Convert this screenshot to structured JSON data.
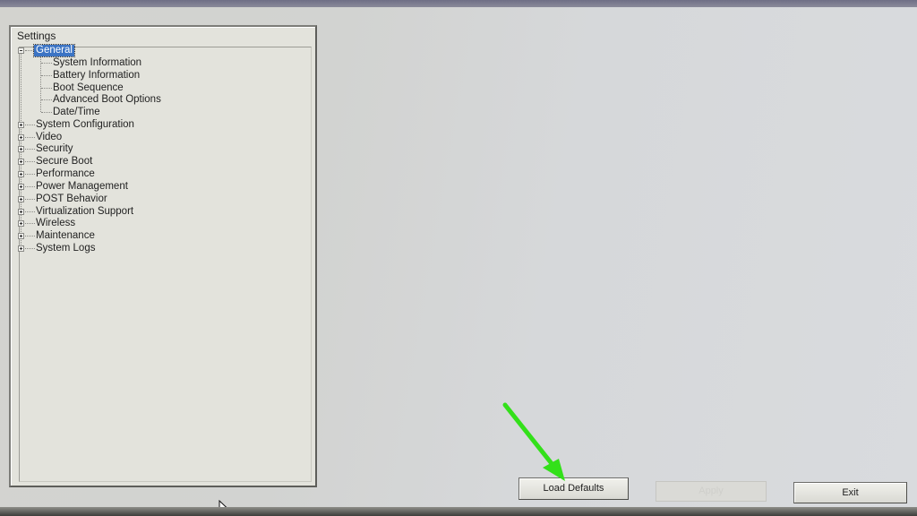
{
  "tree": {
    "title": "Settings",
    "items": [
      {
        "label": "General",
        "level": 0,
        "expander": "minus",
        "selected": true
      },
      {
        "label": "System Information",
        "level": 1
      },
      {
        "label": "Battery Information",
        "level": 1
      },
      {
        "label": "Boot Sequence",
        "level": 1
      },
      {
        "label": "Advanced Boot Options",
        "level": 1
      },
      {
        "label": "Date/Time",
        "level": 1
      },
      {
        "label": "System Configuration",
        "level": 0,
        "expander": "plus"
      },
      {
        "label": "Video",
        "level": 0,
        "expander": "plus"
      },
      {
        "label": "Security",
        "level": 0,
        "expander": "plus"
      },
      {
        "label": "Secure Boot",
        "level": 0,
        "expander": "plus"
      },
      {
        "label": "Performance",
        "level": 0,
        "expander": "plus"
      },
      {
        "label": "Power Management",
        "level": 0,
        "expander": "plus"
      },
      {
        "label": "POST Behavior",
        "level": 0,
        "expander": "plus"
      },
      {
        "label": "Virtualization Support",
        "level": 0,
        "expander": "plus"
      },
      {
        "label": "Wireless",
        "level": 0,
        "expander": "plus"
      },
      {
        "label": "Maintenance",
        "level": 0,
        "expander": "plus"
      },
      {
        "label": "System Logs",
        "level": 0,
        "expander": "plus"
      }
    ]
  },
  "buttons": {
    "load_defaults": "Load Defaults",
    "apply": "Apply",
    "exit": "Exit"
  },
  "colors": {
    "selection": "#3c74c4",
    "annotation_arrow": "#33e01a"
  },
  "icons": {
    "annotation": "arrow-pointing-to-load-defaults",
    "cursor": "mouse-pointer-icon"
  }
}
